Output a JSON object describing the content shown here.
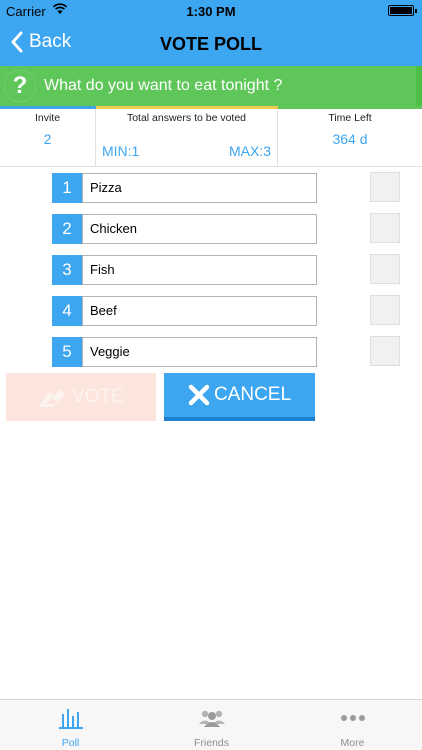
{
  "status_bar": {
    "carrier": "Carrier",
    "time": "1:30 PM"
  },
  "nav": {
    "back_label": "Back",
    "title": "VOTE POLL"
  },
  "question": {
    "text": "What do you want to eat tonight ?",
    "icon_glyph": "?"
  },
  "stats": {
    "invite_label": "Invite",
    "invite_value": "2",
    "total_label": "Total answers to be voted",
    "min_text": "MIN:1",
    "max_text": "MAX:3",
    "time_label": "Time Left",
    "time_value": "364 d"
  },
  "options": [
    {
      "number": "1",
      "label": "Pizza"
    },
    {
      "number": "2",
      "label": "Chicken"
    },
    {
      "number": "3",
      "label": "Fish"
    },
    {
      "number": "4",
      "label": "Beef"
    },
    {
      "number": "5",
      "label": "Veggie"
    }
  ],
  "buttons": {
    "vote_label": "VOTE",
    "cancel_label": "CANCEL"
  },
  "tabs": [
    {
      "label": "Poll",
      "icon": "poll-icon",
      "active": true
    },
    {
      "label": "Friends",
      "icon": "friends-icon",
      "active": false
    },
    {
      "label": "More",
      "icon": "more-icon",
      "active": false
    }
  ],
  "colors": {
    "primary": "#3da6f1",
    "question_bar": "#5fc75a",
    "vote_disabled": "#fbe5dc",
    "accent_strip": [
      "#3da6f1",
      "#f2c94c",
      "#5fc75a"
    ]
  }
}
